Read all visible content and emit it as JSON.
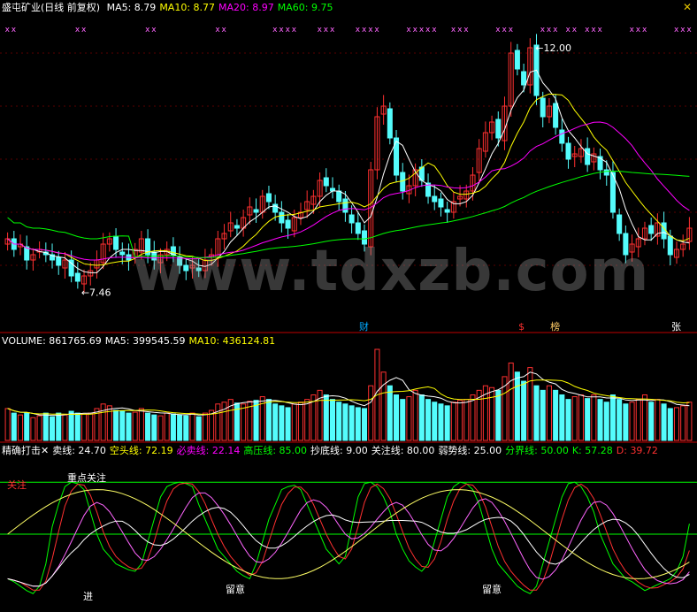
{
  "main": {
    "title": "盛屯矿业(日线 前复权)",
    "ma": [
      {
        "label": "MA5: 8.79",
        "color": "#ffffff"
      },
      {
        "label": "MA10: 8.77",
        "color": "#ffff00"
      },
      {
        "label": "MA20: 8.97",
        "color": "#ff00ff"
      },
      {
        "label": "MA60: 9.75",
        "color": "#00ff00"
      }
    ],
    "high_label": "12.00",
    "low_label": "7.46",
    "event_tags": [
      {
        "text": "财",
        "color": "#00aaff"
      },
      {
        "text": "$",
        "color": "#ff3030"
      },
      {
        "text": "榜",
        "color": "#ffcc66"
      },
      {
        "text": "张",
        "color": "#ffffff"
      }
    ],
    "close_icon": "✕"
  },
  "volume": {
    "items": [
      {
        "label": "VOLUME: 861765.69",
        "color": "#ffffff"
      },
      {
        "label": "MA5: 399545.59",
        "color": "#ffffff"
      },
      {
        "label": "MA10: 436124.81",
        "color": "#ffff00"
      }
    ]
  },
  "indicator": {
    "items": [
      {
        "label": "精确打击✕",
        "color": "#ffffff"
      },
      {
        "label": "卖线: 24.70",
        "color": "#ffffff"
      },
      {
        "label": "空头线: 72.19",
        "color": "#ffff00"
      },
      {
        "label": "必卖线: 22.14",
        "color": "#ff00ff"
      },
      {
        "label": "高压线: 85.00",
        "color": "#00ff00"
      },
      {
        "label": "抄底线: 9.00",
        "color": "#ffffff"
      },
      {
        "label": "关注线: 80.00",
        "color": "#ffffff"
      },
      {
        "label": "弱势线: 25.00",
        "color": "#ffffff"
      },
      {
        "label": "分界线: 50.00",
        "color": "#00ff00"
      },
      {
        "label": "K: 57.28",
        "color": "#00ff00"
      },
      {
        "label": "D: 39.72",
        "color": "#ff3030"
      }
    ],
    "annotations": [
      {
        "text": "关注",
        "color": "#ff3030"
      },
      {
        "text": "重点关注",
        "color": "#ffffff"
      },
      {
        "text": "进",
        "color": "#ffffff"
      },
      {
        "text": "留意",
        "color": "#ffffff"
      },
      {
        "text": "留意",
        "color": "#ffffff"
      }
    ]
  },
  "watermark": "www.tdxzb.com",
  "chart_data": {
    "type": "candlestick",
    "title": "盛屯矿业(日线 前复权)",
    "ylim": [
      6.8,
      12.3
    ],
    "low_marker": 7.46,
    "high_marker": 12.0,
    "close": [
      8.3,
      8.1,
      8.2,
      7.9,
      8.0,
      8.1,
      8.0,
      7.9,
      7.8,
      7.9,
      7.6,
      7.5,
      7.6,
      7.7,
      7.9,
      8.2,
      8.3,
      8.1,
      8.0,
      7.9,
      8.1,
      8.3,
      8.0,
      7.9,
      8.0,
      8.1,
      8.0,
      7.8,
      7.7,
      7.8,
      7.7,
      7.9,
      8.0,
      8.3,
      8.4,
      8.6,
      8.5,
      8.7,
      8.9,
      8.8,
      9.1,
      9.0,
      8.8,
      8.6,
      8.5,
      8.7,
      8.8,
      9.0,
      9.1,
      9.4,
      9.3,
      9.2,
      9.0,
      8.8,
      8.6,
      8.4,
      8.2,
      9.6,
      10.6,
      10.8,
      10.2,
      9.5,
      9.2,
      9.3,
      9.6,
      9.4,
      9.1,
      9.0,
      8.9,
      8.8,
      9.0,
      9.1,
      9.2,
      9.5,
      10.0,
      10.3,
      10.5,
      10.2,
      10.8,
      11.8,
      11.5,
      11.2,
      11.9,
      11.0,
      10.6,
      10.8,
      10.4,
      10.1,
      9.8,
      9.9,
      10.0,
      9.7,
      9.9,
      9.6,
      9.5,
      8.8,
      8.4,
      8.0,
      8.2,
      8.3,
      8.5,
      8.4,
      8.6,
      8.3,
      8.0,
      8.1,
      8.2,
      8.5
    ],
    "volume": [
      0.35,
      0.3,
      0.28,
      0.3,
      0.25,
      0.27,
      0.3,
      0.26,
      0.3,
      0.28,
      0.32,
      0.3,
      0.29,
      0.3,
      0.35,
      0.4,
      0.38,
      0.33,
      0.32,
      0.3,
      0.31,
      0.35,
      0.3,
      0.28,
      0.27,
      0.3,
      0.29,
      0.28,
      0.27,
      0.3,
      0.26,
      0.3,
      0.33,
      0.4,
      0.42,
      0.45,
      0.41,
      0.4,
      0.43,
      0.44,
      0.48,
      0.45,
      0.4,
      0.38,
      0.36,
      0.4,
      0.42,
      0.45,
      0.5,
      0.55,
      0.5,
      0.45,
      0.42,
      0.4,
      0.38,
      0.36,
      0.35,
      0.6,
      1.0,
      0.75,
      0.6,
      0.5,
      0.45,
      0.48,
      0.55,
      0.5,
      0.45,
      0.42,
      0.4,
      0.38,
      0.42,
      0.44,
      0.45,
      0.5,
      0.55,
      0.6,
      0.58,
      0.55,
      0.7,
      0.85,
      0.75,
      0.65,
      0.8,
      0.6,
      0.55,
      0.6,
      0.55,
      0.5,
      0.45,
      0.48,
      0.5,
      0.46,
      0.5,
      0.45,
      0.42,
      0.5,
      0.45,
      0.4,
      0.42,
      0.45,
      0.5,
      0.42,
      0.45,
      0.4,
      0.35,
      0.36,
      0.38,
      0.42
    ],
    "k": [
      20,
      18,
      15,
      12,
      10,
      15,
      30,
      55,
      70,
      82,
      85,
      84,
      80,
      65,
      50,
      40,
      35,
      30,
      28,
      26,
      25,
      30,
      45,
      60,
      75,
      82,
      84,
      85,
      84,
      82,
      70,
      60,
      50,
      40,
      35,
      30,
      25,
      22,
      20,
      30,
      45,
      60,
      70,
      80,
      82,
      83,
      80,
      70,
      60,
      50,
      40,
      35,
      30,
      35,
      55,
      75,
      84,
      85,
      82,
      75,
      65,
      50,
      40,
      32,
      28,
      25,
      30,
      45,
      60,
      75,
      82,
      85,
      84,
      80,
      70,
      55,
      40,
      30,
      25,
      20,
      15,
      12,
      10,
      15,
      30,
      45,
      60,
      75,
      84,
      85,
      82,
      75,
      65,
      50,
      40,
      30,
      25,
      20,
      18,
      15,
      12,
      14,
      16,
      18,
      20,
      25,
      35,
      57
    ]
  }
}
